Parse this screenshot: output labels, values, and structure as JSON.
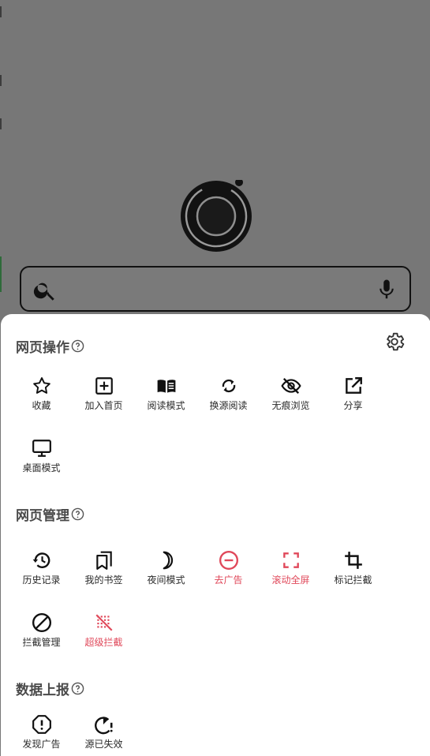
{
  "colors": {
    "accent_red": "#e0485a",
    "text_dark": "#2a2a2a",
    "section_text": "#4a4a4a",
    "sheet_bg": "#ffffff"
  },
  "search": {
    "search_icon": "search-icon",
    "mic_icon": "mic-icon"
  },
  "sections": [
    {
      "title": "网页操作",
      "items": [
        {
          "label": "收藏",
          "icon": "star-icon"
        },
        {
          "label": "加入首页",
          "icon": "add-box-icon"
        },
        {
          "label": "阅读模式",
          "icon": "book-open-icon"
        },
        {
          "label": "换源阅读",
          "icon": "refresh-icon"
        },
        {
          "label": "无痕浏览",
          "icon": "eye-off-icon"
        },
        {
          "label": "分享",
          "icon": "share-icon"
        },
        {
          "label": "桌面模式",
          "icon": "monitor-icon"
        }
      ]
    },
    {
      "title": "网页管理",
      "items": [
        {
          "label": "历史记录",
          "icon": "history-icon"
        },
        {
          "label": "我的书签",
          "icon": "bookmarks-icon"
        },
        {
          "label": "夜间模式",
          "icon": "moon-icon"
        },
        {
          "label": "去广告",
          "icon": "minus-circle-icon",
          "highlight": true
        },
        {
          "label": "滚动全屏",
          "icon": "fullscreen-icon",
          "highlight": true
        },
        {
          "label": "标记拦截",
          "icon": "crop-icon"
        },
        {
          "label": "拦截管理",
          "icon": "block-icon"
        },
        {
          "label": "超级拦截",
          "icon": "grid-off-icon",
          "highlight": true
        }
      ]
    },
    {
      "title": "数据上报",
      "items": [
        {
          "label": "发现广告",
          "icon": "alert-octagon-icon"
        },
        {
          "label": "源已失效",
          "icon": "pie-alert-icon"
        }
      ]
    }
  ]
}
